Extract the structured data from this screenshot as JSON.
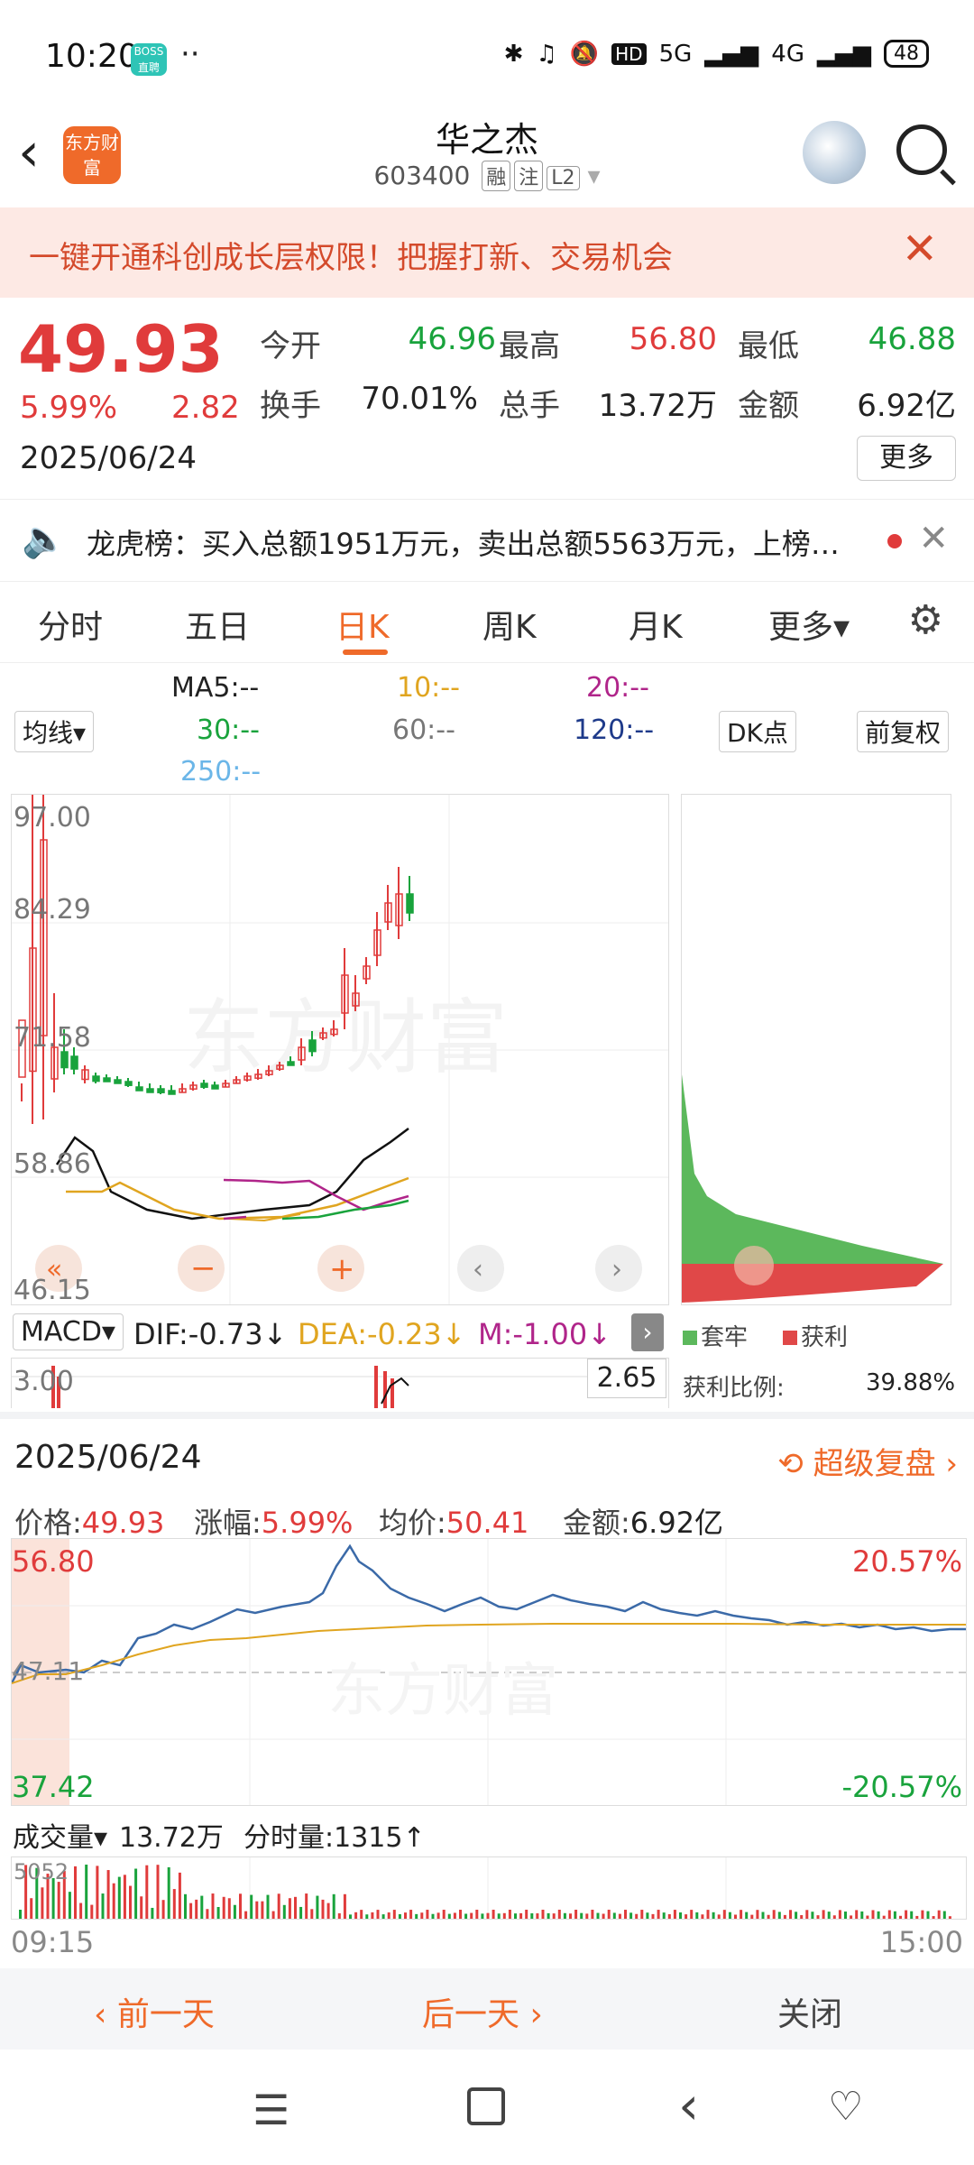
{
  "status_bar": {
    "time": "10:20",
    "boss_badge": "BOSS直聘",
    "extra": "··",
    "network": "5G",
    "network2": "4G",
    "battery": "48"
  },
  "header": {
    "logo_text": "东方财富",
    "title": "华之杰",
    "code": "603400",
    "tags": [
      "融",
      "注",
      "L2"
    ]
  },
  "banner": {
    "text": "一键开通科创成长层权限！把握打新、交易机会"
  },
  "quote": {
    "price": "49.93",
    "change_pct": "5.99%",
    "change": "2.82",
    "date": "2025/06/24",
    "fields": [
      {
        "label": "今开",
        "value": "46.96",
        "color": "green"
      },
      {
        "label": "最高",
        "value": "56.80",
        "color": "red"
      },
      {
        "label": "最低",
        "value": "46.88",
        "color": "green"
      },
      {
        "label": "换手",
        "value": "70.01%",
        "color": "black"
      },
      {
        "label": "总手",
        "value": "13.72万",
        "color": "black"
      },
      {
        "label": "金额",
        "value": "6.92亿",
        "color": "black"
      }
    ],
    "more_label": "更多"
  },
  "news": {
    "text": "龙虎榜：买入总额1951万元，卖出总额5563万元，上榜…"
  },
  "tabs": [
    "分时",
    "五日",
    "日K",
    "周K",
    "月K",
    "更多▾"
  ],
  "active_tab": "日K",
  "ma_legend": {
    "selector": "均线▾",
    "ma5": "MA5:--",
    "ma10": "10:--",
    "ma20": "20:--",
    "ma30": "30:--",
    "ma60": "60:--",
    "ma120": "120:--",
    "ma250": "250:--",
    "dk_label": "DK点",
    "fq_label": "前复权"
  },
  "kline": {
    "y_labels": [
      "97.00",
      "84.29",
      "71.58",
      "58.86",
      "46.15"
    ],
    "watermark": "东方财富"
  },
  "profile": {
    "legend_trapped": "套牢",
    "legend_profit": "获利",
    "ratio_label": "获利比例:",
    "ratio_value": "39.88%"
  },
  "macd": {
    "selector": "MACD▾",
    "dif": "DIF:-0.73↓",
    "dea": "DEA:-0.23↓",
    "m": "M:-1.00↓",
    "top_label": "3.00",
    "cur_value": "2.65"
  },
  "detail": {
    "date": "2025/06/24",
    "replay_label": "超级复盘",
    "price_label": "价格:",
    "price": "49.93",
    "pct_label": "涨幅:",
    "pct": "5.99%",
    "avg_label": "均价:",
    "avg": "50.41",
    "amt_label": "金额:",
    "amt": "6.92亿",
    "y_top": "56.80",
    "y_mid": "47.11",
    "y_bot": "37.42",
    "pct_top": "20.57%",
    "pct_bot": "-20.57%",
    "vol_selector": "成交量▾",
    "vol_total": "13.72万",
    "vol_now_label": "分时量:",
    "vol_now": "1315↑",
    "vol_max": "5052",
    "time_start": "09:15",
    "time_end": "15:00"
  },
  "actions": {
    "prev": "前一天",
    "next": "后一天",
    "close": "关闭"
  },
  "colors": {
    "accent": "#ef6a2a",
    "up": "#e03b3b",
    "down": "#19a33c"
  }
}
